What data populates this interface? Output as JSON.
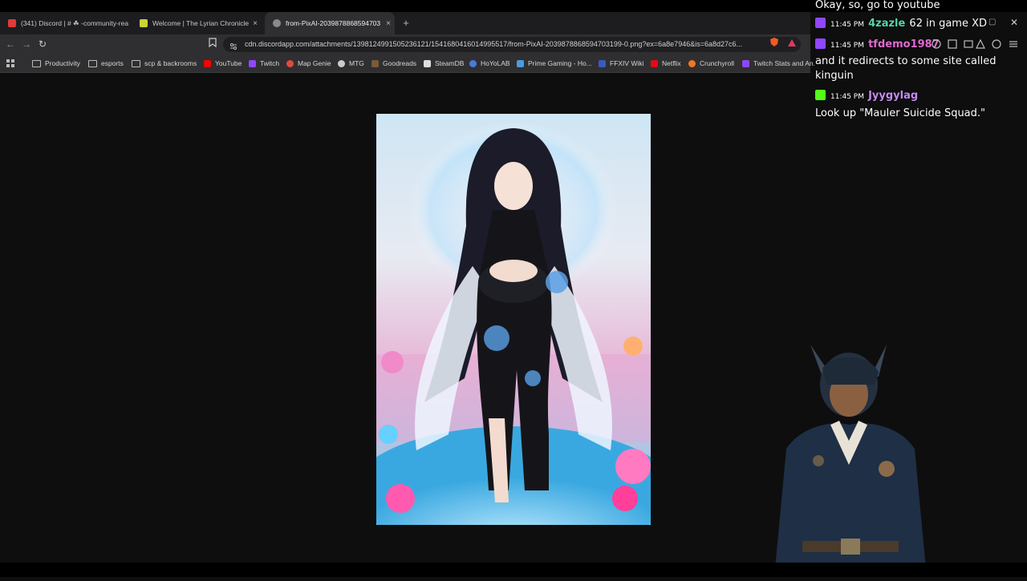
{
  "browser": {
    "tabs": [
      {
        "title": "(341) Discord | # ☘ -community-rea",
        "favicon_color": "#e03a3a",
        "active": false
      },
      {
        "title": "Welcome | The Lyrian Chronicle",
        "favicon_color": "#c9d33a",
        "active": false
      },
      {
        "title": "from-PixAI-2039878868594703",
        "favicon_color": "#8a8a8a",
        "active": true
      }
    ],
    "new_tab_symbol": "+",
    "close_symbol": "×",
    "url": "cdn.discordapp.com/attachments/1398124991505236121/1541680416014995517/from-PixAI-2039878868594703199-0.png?ex=6a8e7946&is=6a8d27c6...",
    "nav": {
      "back": "←",
      "forward": "→",
      "reload": "↻"
    }
  },
  "bookmarks": [
    {
      "label": "Productivity",
      "type": "folder"
    },
    {
      "label": "esports",
      "type": "folder"
    },
    {
      "label": "scp & backrooms",
      "type": "folder"
    },
    {
      "label": "YouTube",
      "type": "site",
      "color": "#ff0000"
    },
    {
      "label": "Twitch",
      "type": "site",
      "color": "#9146ff"
    },
    {
      "label": "Map Genie",
      "type": "site",
      "color": "#e04a3a"
    },
    {
      "label": "MTG",
      "type": "site",
      "color": "#cccccc"
    },
    {
      "label": "Goodreads",
      "type": "site",
      "color": "#7a5a3a"
    },
    {
      "label": "SteamDB",
      "type": "site",
      "color": "#dddddd"
    },
    {
      "label": "HoYoLAB",
      "type": "site",
      "color": "#4a7ae0"
    },
    {
      "label": "Prime Gaming - Ho...",
      "type": "site",
      "color": "#4a9ae0"
    },
    {
      "label": "FFXIV Wiki",
      "type": "site",
      "color": "#3a5ac0"
    },
    {
      "label": "Netflix",
      "type": "site",
      "color": "#e50914"
    },
    {
      "label": "Crunchyroll",
      "type": "site",
      "color": "#f47521"
    },
    {
      "label": "Twitch Stats and An...",
      "type": "site",
      "color": "#9146ff"
    }
  ],
  "chat": {
    "partial_message": "Okay, so, go to youtube",
    "messages": [
      {
        "time": "11:45 PM",
        "user": "4zazle",
        "user_color": "#55d6a6",
        "platform": "twitch",
        "text": "62 in game XD"
      },
      {
        "time": "11:45 PM",
        "user": "tfdemo1987",
        "user_color": "#e06bd0",
        "platform": "twitch",
        "text": "and it redirects to some site called kinguin"
      },
      {
        "time": "11:45 PM",
        "user": "Jyygylag",
        "user_color": "#c48bf0",
        "platform": "kick",
        "text": "Look up \"Mauler Suicide Squad.\""
      }
    ]
  },
  "colors": {
    "twitch": "#9146ff",
    "kick": "#53fc18"
  }
}
